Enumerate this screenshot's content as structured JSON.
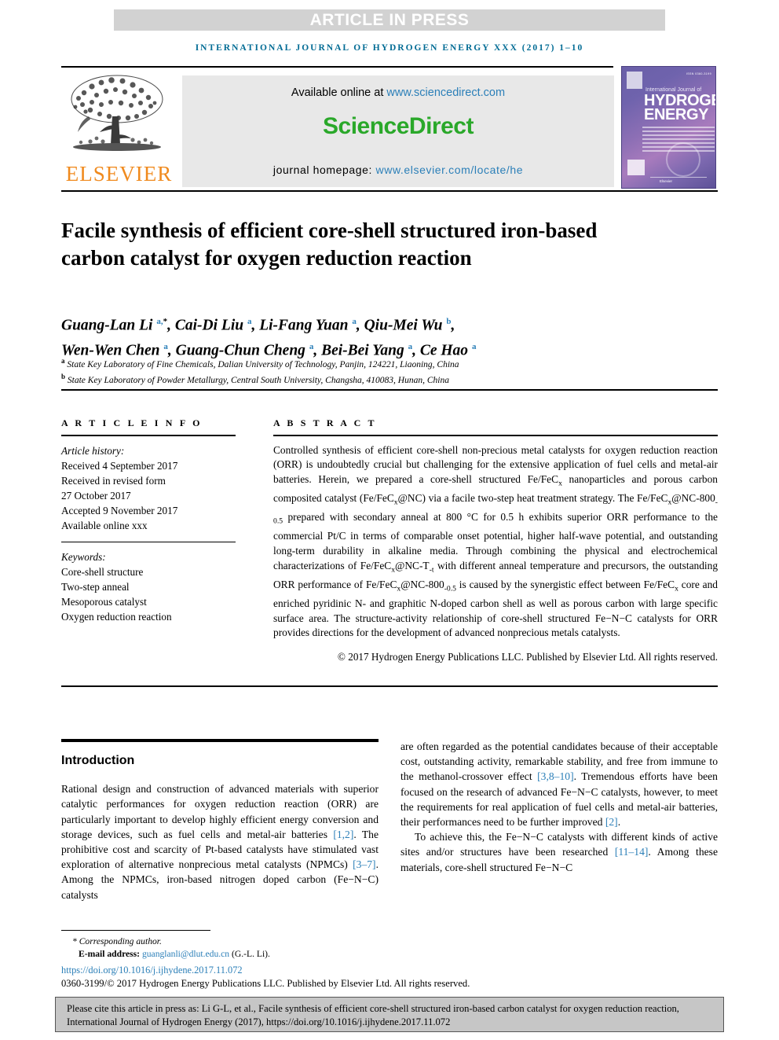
{
  "banner": {
    "text": "ARTICLE IN PRESS"
  },
  "running_head": {
    "text": "INTERNATIONAL JOURNAL OF HYDROGEN ENERGY XXX (2017) 1–10"
  },
  "publisher": {
    "elsevier_wordmark": "ELSEVIER",
    "available_prefix": "Available online at ",
    "available_url": "www.sciencedirect.com",
    "sciencedirect_logo": "ScienceDirect",
    "homepage_prefix": "journal homepage: ",
    "homepage_url": "www.elsevier.com/locate/he"
  },
  "cover": {
    "supertitle": "International Journal of",
    "title_line1": "HYDROGEN",
    "title_line2": "ENERGY",
    "issn_badge": "ISSN 0360-3199",
    "footer_label": "Elsevier"
  },
  "article": {
    "title": "Facile synthesis of efficient core-shell structured iron-based carbon catalyst for oxygen reduction reaction",
    "authors_line1_parts": [
      {
        "name": "Guang-Lan Li ",
        "sup": "a,",
        "star": "*"
      },
      {
        "name": ", Cai-Di Liu ",
        "sup": "a"
      },
      {
        "name": ", Li-Fang Yuan ",
        "sup": "a"
      },
      {
        "name": ", Qiu-Mei Wu ",
        "sup": "b"
      },
      {
        "name": ","
      }
    ],
    "authors_line2_parts": [
      {
        "name": "Wen-Wen Chen ",
        "sup": "a"
      },
      {
        "name": ", Guang-Chun Cheng ",
        "sup": "a"
      },
      {
        "name": ", Bei-Bei Yang ",
        "sup": "a"
      },
      {
        "name": ", Ce Hao ",
        "sup": "a"
      }
    ],
    "affiliations": [
      {
        "marker": "a",
        "text": "State Key Laboratory of Fine Chemicals, Dalian University of Technology, Panjin, 124221, Liaoning, China"
      },
      {
        "marker": "b",
        "text": "State Key Laboratory of Powder Metallurgy, Central South University, Changsha, 410083, Hunan, China"
      }
    ]
  },
  "article_info": {
    "heading": "A R T I C L E   I N F O",
    "history_label": "Article history:",
    "history": [
      "Received 4 September 2017",
      "Received in revised form",
      "27 October 2017",
      "Accepted 9 November 2017",
      "Available online xxx"
    ],
    "keywords_label": "Keywords:",
    "keywords": [
      "Core-shell structure",
      "Two-step anneal",
      "Mesoporous catalyst",
      "Oxygen reduction reaction"
    ]
  },
  "abstract": {
    "heading": "A B S T R A C T",
    "paragraph_1": "Controlled synthesis of efficient core-shell non-precious metal catalysts for oxygen reduction reaction (ORR) is undoubtedly crucial but challenging for the extensive application of fuel cells and metal-air batteries. Herein, we prepared a core-shell structured Fe/",
    "paragraph_2": " nanoparticles and porous carbon composited catalyst (Fe/FeC",
    "paragraph_3": "@NC) via a facile two-step heat treatment strategy. The Fe/FeC",
    "paragraph_4": "@NC-800",
    "paragraph_5": " prepared with secondary anneal at 800 °C for 0.5 h exhibits superior ORR performance to the commercial Pt/C in terms of comparable onset potential, higher half-wave potential, and outstanding long-term durability in alkaline media. Through combining the physical and electrochemical characterizations of Fe/FeC",
    "paragraph_6": "@NC-T",
    "paragraph_7": " with different anneal temperature and precursors, the outstanding ORR performance of Fe/FeC",
    "paragraph_8": "@NC-800",
    "paragraph_9": " is caused by the synergistic effect between Fe/FeC",
    "paragraph_10": " core and enriched pyridinic N- and graphitic N-doped carbon shell as well as porous carbon with large specific surface area. The structure-activity relationship of core-shell structured Fe−N−C catalysts for ORR provides directions for the development of advanced nonprecious metals catalysts.",
    "fecx_lead": "FeC",
    "sub_x": "x",
    "sub_05": "-0.5",
    "sub_t": "-t",
    "copyright": "© 2017 Hydrogen Energy Publications LLC. Published by Elsevier Ltd. All rights reserved."
  },
  "introduction": {
    "heading": "Introduction",
    "left_p1_a": "Rational design and construction of advanced materials with superior catalytic performances for oxygen reduction reaction (ORR) are particularly important to develop highly efficient energy conversion and storage devices, such as fuel cells and metal-air batteries ",
    "left_ref_1": "[1,2]",
    "left_p1_b": ". The prohibitive cost and scarcity of Pt-based catalysts have stimulated vast exploration of alternative nonprecious metal catalysts (NPMCs) ",
    "left_ref_2": "[3–7]",
    "left_p1_c": ". Among the NPMCs, iron-based nitrogen doped carbon (Fe−N−C) catalysts",
    "right_p1_a": "are often regarded as the potential candidates because of their acceptable cost, outstanding activity, remarkable stability, and free from immune to the methanol-crossover effect ",
    "right_ref_1": "[3,8–10]",
    "right_p1_b": ". Tremendous efforts have been focused on the research of advanced Fe−N−C catalysts, however, to meet the requirements for real application of fuel cells and metal-air batteries, their performances need to be further improved ",
    "right_ref_2": "[2]",
    "right_p1_c": ".",
    "right_p2_a": "To achieve this, the Fe−N−C catalysts with different kinds of active sites and/or structures have been researched ",
    "right_ref_3": "[11–14]",
    "right_p2_b": ". Among these materials, core-shell structured Fe−N−C"
  },
  "footnotes": {
    "corresponding": "* Corresponding author.",
    "email_label": "E-mail address: ",
    "email": "guanglanli@dlut.edu.cn",
    "email_suffix": " (G.-L. Li).",
    "doi": "https://doi.org/10.1016/j.ijhydene.2017.11.072",
    "issn_copyright": "0360-3199/© 2017 Hydrogen Energy Publications LLC. Published by Elsevier Ltd. All rights reserved."
  },
  "cite_box": {
    "text": "Please cite this article in press as: Li G-L, et al., Facile synthesis of efficient core-shell structured iron-based carbon catalyst for oxygen reduction reaction, International Journal of Hydrogen Energy (2017), https://doi.org/10.1016/j.ijhydene.2017.11.072"
  },
  "colors": {
    "link": "#2b7fb8",
    "journal_head": "#006b94",
    "elsevier_orange": "#f08a1e",
    "sciencedirect_green": "#2aa82a",
    "banner_bg": "#d2d2d2",
    "cite_bg": "#c6c6c6"
  }
}
